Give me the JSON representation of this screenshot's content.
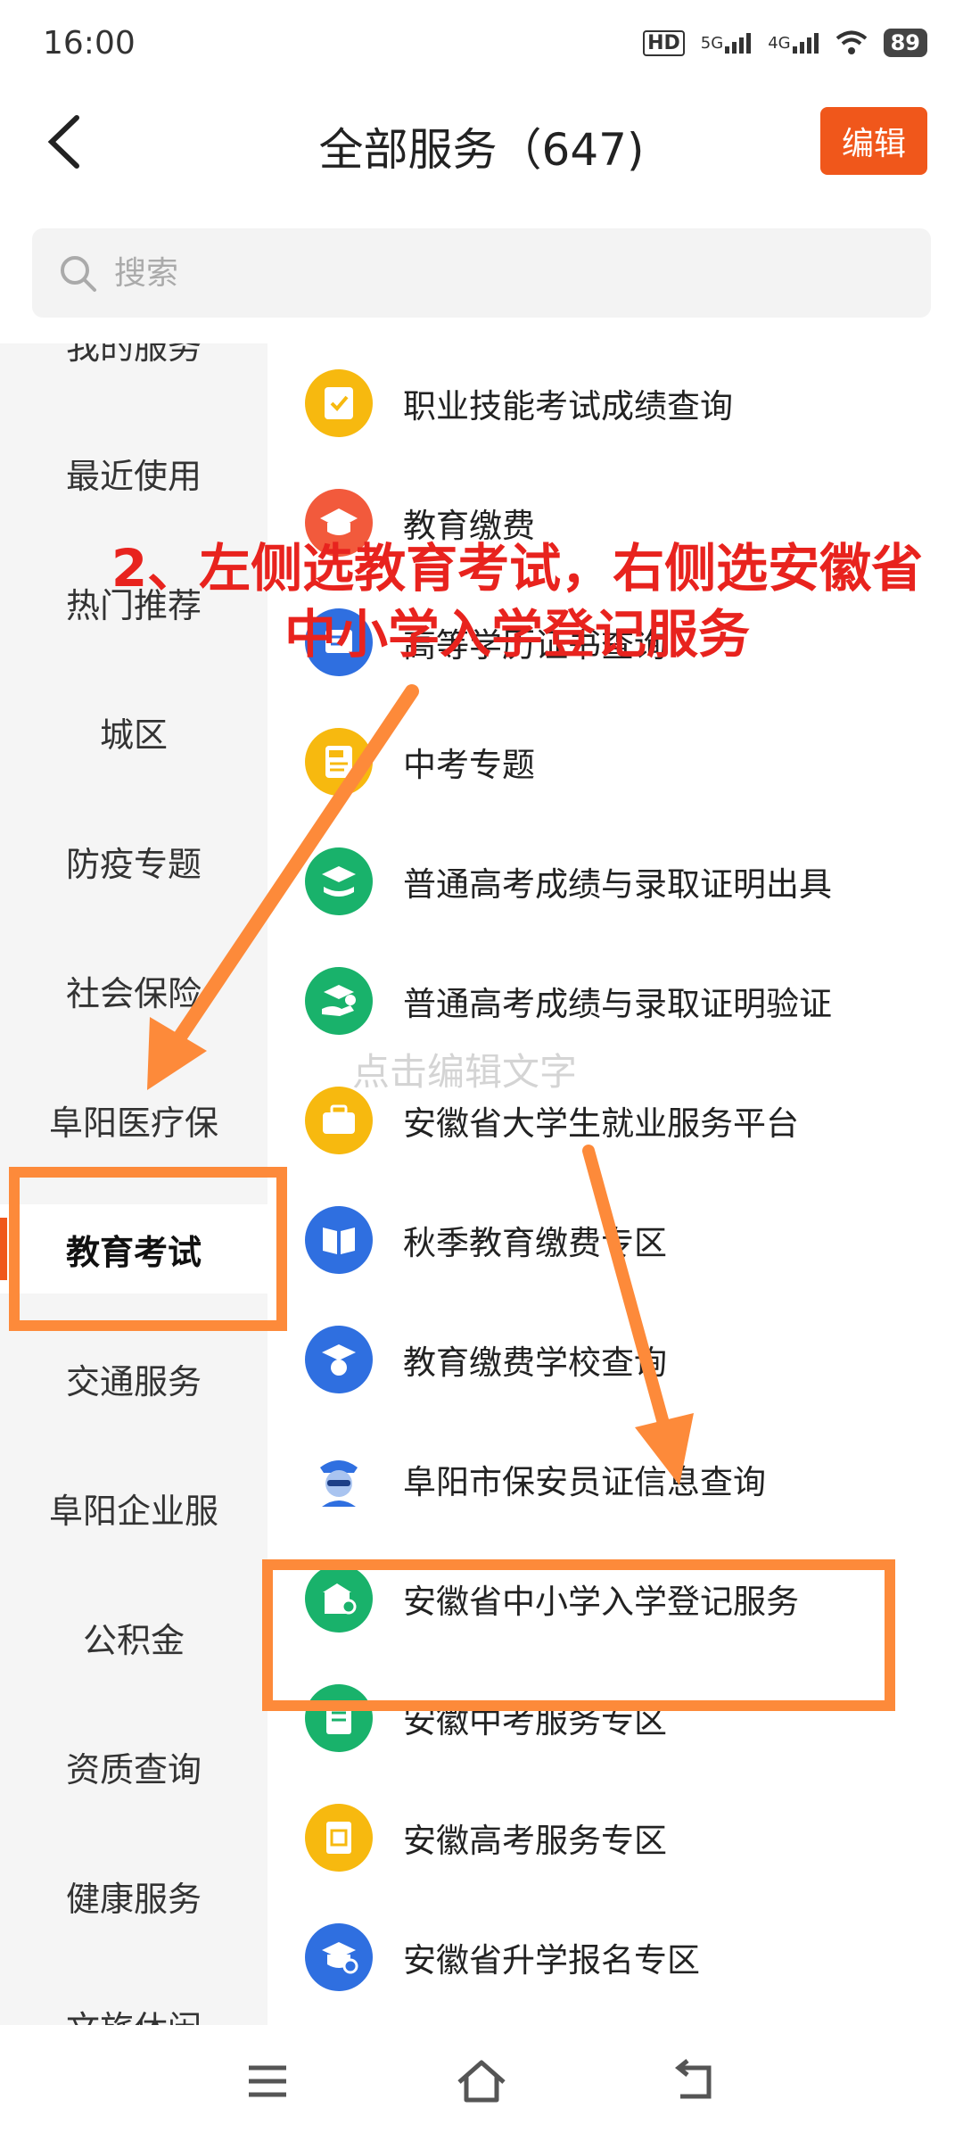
{
  "status": {
    "time": "16:00",
    "hd": "HD",
    "net1": "5G",
    "net2": "4G",
    "battery": "89"
  },
  "header": {
    "title": "全部服务（647)",
    "edit_label": "编辑"
  },
  "search": {
    "placeholder": "搜索"
  },
  "sidebar": {
    "items": [
      {
        "label": "我的服务"
      },
      {
        "label": "最近使用"
      },
      {
        "label": "热门推荐"
      },
      {
        "label": "城区"
      },
      {
        "label": "防疫专题"
      },
      {
        "label": "社会保险"
      },
      {
        "label": "阜阳医疗保"
      },
      {
        "label": "教育考试"
      },
      {
        "label": "交通服务"
      },
      {
        "label": "阜阳企业服"
      },
      {
        "label": "公积金"
      },
      {
        "label": "资质查询"
      },
      {
        "label": "健康服务"
      },
      {
        "label": "文旅休闲"
      }
    ],
    "active_color": "#f0571b"
  },
  "services": {
    "items": [
      {
        "label": "职业技能考试成绩查询",
        "icon": "checklist-icon",
        "color": "#f7b90f"
      },
      {
        "label": "教育缴费",
        "icon": "graduation-cap-icon",
        "color": "#f25a3c"
      },
      {
        "label": "高等学历证书查询",
        "icon": "certificate-icon",
        "color": "#2f6fe0"
      },
      {
        "label": "中考专题",
        "icon": "exam-icon",
        "color": "#f7b90f"
      },
      {
        "label": "普通高考成绩与录取证明出具",
        "icon": "book-cap-icon",
        "color": "#19b26b"
      },
      {
        "label": "普通高考成绩与录取证明验证",
        "icon": "hand-cap-icon",
        "color": "#19b26b"
      },
      {
        "label": "安徽省大学生就业服务平台",
        "icon": "briefcase-icon",
        "color": "#f7b90f"
      },
      {
        "label": "秋季教育缴费专区",
        "icon": "book-icon",
        "color": "#2f6fe0"
      },
      {
        "label": "教育缴费学校查询",
        "icon": "cap-coin-icon",
        "color": "#2f6fe0"
      },
      {
        "label": "阜阳市保安员证信息查询",
        "icon": "guard-icon",
        "color": "#2f6fe0"
      },
      {
        "label": "安徽省中小学入学登记服务",
        "icon": "school-icon",
        "color": "#19b26b"
      },
      {
        "label": "安徽中考服务专区",
        "icon": "document-icon",
        "color": "#19b26b"
      },
      {
        "label": "安徽高考服务专区",
        "icon": "gaokao-icon",
        "color": "#f7b90f"
      },
      {
        "label": "安徽省升学报名专区",
        "icon": "cap-pen-icon",
        "color": "#2f6fe0"
      }
    ]
  },
  "annotation": {
    "instruction": "2、左侧选教育考试，右侧选安徽省中小学入学登记服务",
    "watermark": "点击编辑文字",
    "color": "#e8231e",
    "arrow_color": "#fd8a3a"
  }
}
